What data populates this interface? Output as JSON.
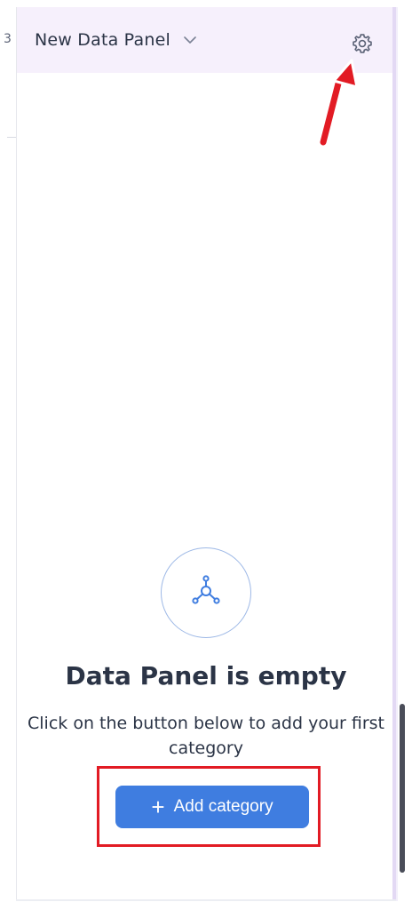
{
  "header": {
    "title": "New Data Panel",
    "chevron_icon": "chevron-down-icon",
    "settings_icon": "gear-icon"
  },
  "left_sliver": {
    "glyph": "3"
  },
  "empty_state": {
    "icon": "network-graph-icon",
    "title": "Data Panel is empty",
    "description": "Click on the button below to add your first category",
    "button": {
      "icon": "plus-icon",
      "label": "Add category"
    }
  },
  "annotations": {
    "arrow_color": "#e21b24",
    "highlight_color": "#e21b24"
  },
  "colors": {
    "accent": "#3f7de0",
    "header_bg": "#f6f0fc",
    "text": "#2b3446"
  }
}
